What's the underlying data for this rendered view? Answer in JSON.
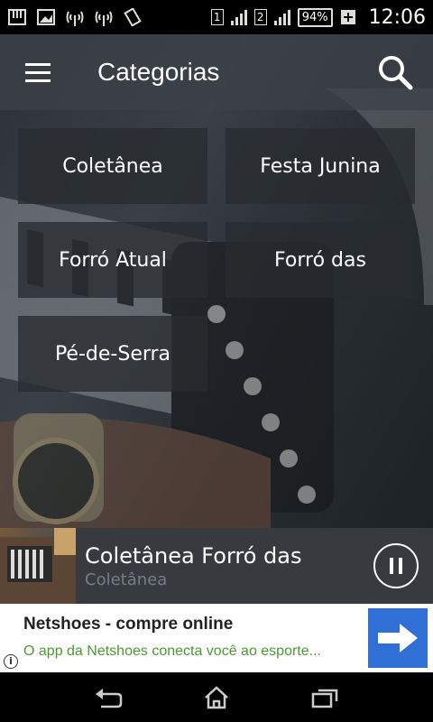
{
  "status_bar": {
    "sim2": "2",
    "sim1": "1",
    "battery": "94%",
    "time": "12:06"
  },
  "app_bar": {
    "title": "Categorias"
  },
  "categories": [
    {
      "label": "Coletânea"
    },
    {
      "label": "Festa Junina"
    },
    {
      "label": "Forró Atual"
    },
    {
      "label": "Forró das"
    },
    {
      "label": "Pé-de-Serra"
    }
  ],
  "player": {
    "title": "Coletânea Forró das",
    "subtitle": "Coletânea"
  },
  "ad": {
    "title": "Netshoes - compre online",
    "description": "O app da Netshoes conecta você ao esporte...",
    "info": "i"
  },
  "colors": {
    "ad_button": "#2f6fd6",
    "ad_desc": "#4a9a2e"
  }
}
